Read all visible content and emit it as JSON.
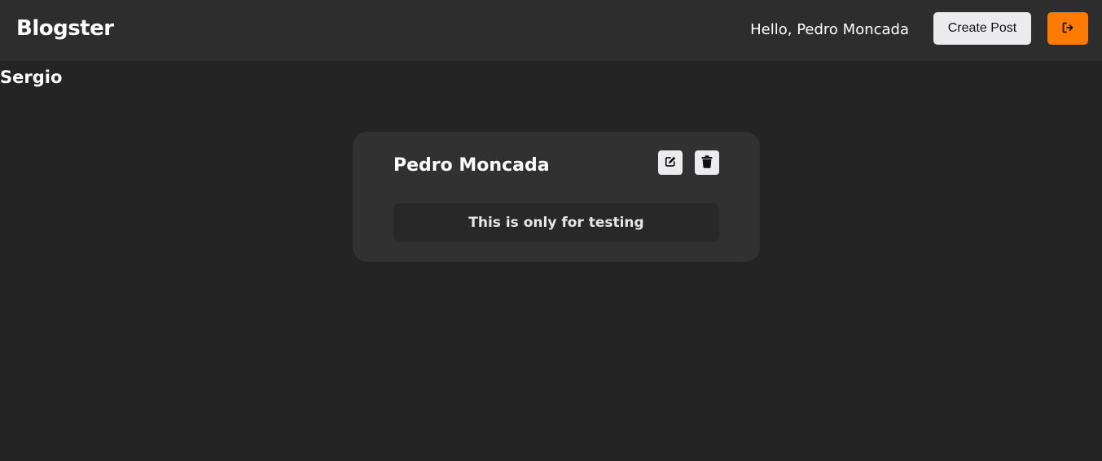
{
  "navbar": {
    "brand": "Blogster",
    "greeting": "Hello, Pedro Moncada",
    "create_post_label": "Create Post",
    "logout_icon": "sign-out-icon",
    "accent_color": "#ff7a00"
  },
  "page": {
    "heading": "Sergio"
  },
  "posts": [
    {
      "author": "Pedro Moncada",
      "content": "This is only for testing",
      "edit_icon": "edit-icon",
      "delete_icon": "trash-icon"
    }
  ]
}
